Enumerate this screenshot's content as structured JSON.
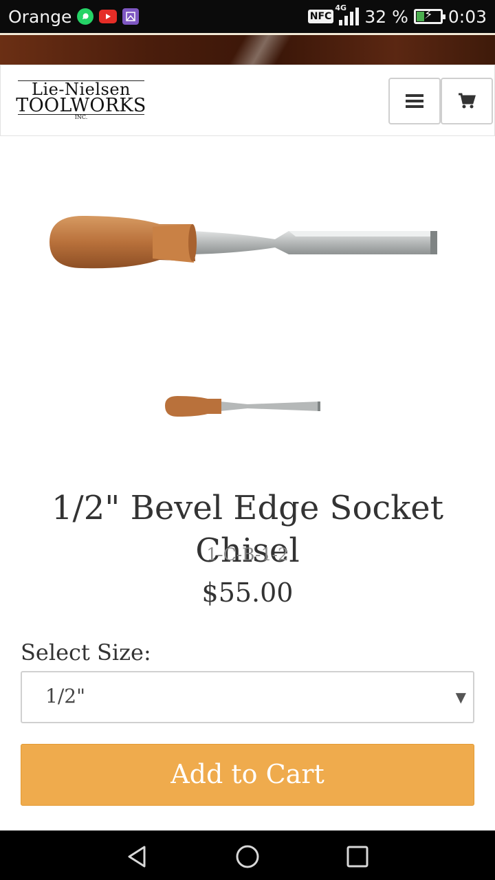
{
  "status_bar": {
    "carrier": "Orange",
    "network": "4G",
    "nfc": "NFC",
    "battery": "32 %",
    "time": "0:03",
    "icons": [
      "whatsapp-icon",
      "youtube-icon",
      "gallery-icon",
      "nfc-icon",
      "signal-icon",
      "battery-charging-icon"
    ]
  },
  "header": {
    "logo": {
      "line1": "Lie-Nielsen",
      "line2": "TOOLWORKS",
      "line3": "INC."
    },
    "menu_icon": "hamburger-icon",
    "cart_icon": "shopping-cart-icon"
  },
  "product": {
    "title": "1/2\" Bevel Edge Socket Chisel",
    "sku": "1-C-B-1-2",
    "price": "$55.00",
    "size_label": "Select Size:",
    "size_selected": "1/2\"",
    "add_to_cart": "Add to Cart",
    "colors": {
      "button": "#efab4d",
      "handle": "#b9713b",
      "blade": "#b5b8b8"
    }
  },
  "nav_bar": {
    "icons": [
      "back-icon",
      "home-icon",
      "recents-icon"
    ]
  }
}
